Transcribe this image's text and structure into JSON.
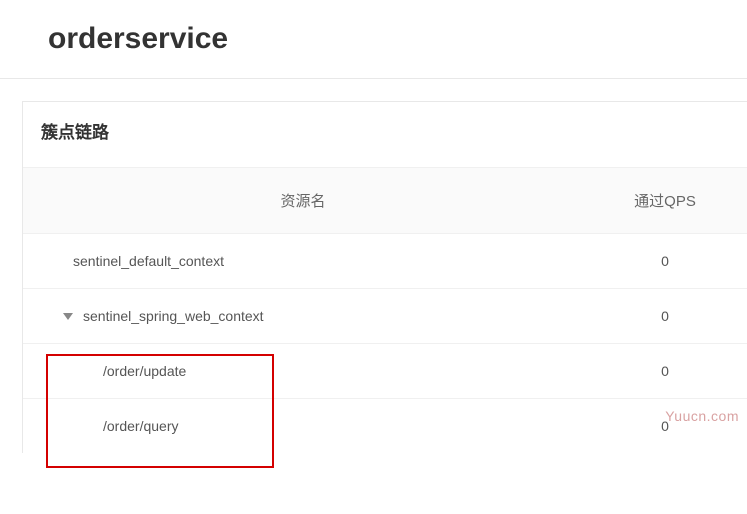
{
  "page": {
    "title": "orderservice"
  },
  "panel": {
    "title": "簇点链路"
  },
  "table": {
    "headers": {
      "resource": "资源名",
      "qps": "通过QPS"
    },
    "rows": [
      {
        "resource": "sentinel_default_context",
        "qps": "0",
        "type": "root"
      },
      {
        "resource": "sentinel_spring_web_context",
        "qps": "0",
        "type": "expandable"
      },
      {
        "resource": "/order/update",
        "qps": "0",
        "type": "child"
      },
      {
        "resource": "/order/query",
        "qps": "0",
        "type": "child"
      }
    ]
  },
  "watermark": "Yuucn.com"
}
